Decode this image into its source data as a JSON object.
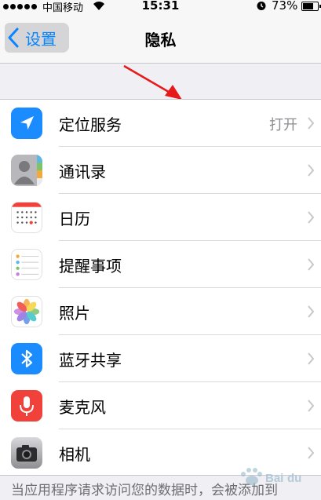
{
  "status_bar": {
    "carrier": "中国移动",
    "time": "15:31",
    "battery_percent": "73%",
    "battery_level": 0.73
  },
  "nav": {
    "back_label": "设置",
    "title": "隐私"
  },
  "rows": [
    {
      "label": "定位服务",
      "value": "打开",
      "icon": "location-arrow-icon",
      "color": "#1a8cff"
    },
    {
      "label": "通讯录",
      "value": "",
      "icon": "contacts-icon",
      "color": "#9a9a9e"
    },
    {
      "label": "日历",
      "value": "",
      "icon": "calendar-icon",
      "color": "#ffffff"
    },
    {
      "label": "提醒事项",
      "value": "",
      "icon": "reminders-icon",
      "color": "#ffffff"
    },
    {
      "label": "照片",
      "value": "",
      "icon": "photos-icon",
      "color": "#ffffff"
    },
    {
      "label": "蓝牙共享",
      "value": "",
      "icon": "bluetooth-icon",
      "color": "#1a8cff"
    },
    {
      "label": "麦克风",
      "value": "",
      "icon": "microphone-icon",
      "color": "#f0413a"
    },
    {
      "label": "相机",
      "value": "",
      "icon": "camera-icon",
      "color": "#5a5a5e"
    }
  ],
  "footer_text": "当应用程序请求访问您的数据时，会被添加到",
  "watermark": "Bai du 经验"
}
